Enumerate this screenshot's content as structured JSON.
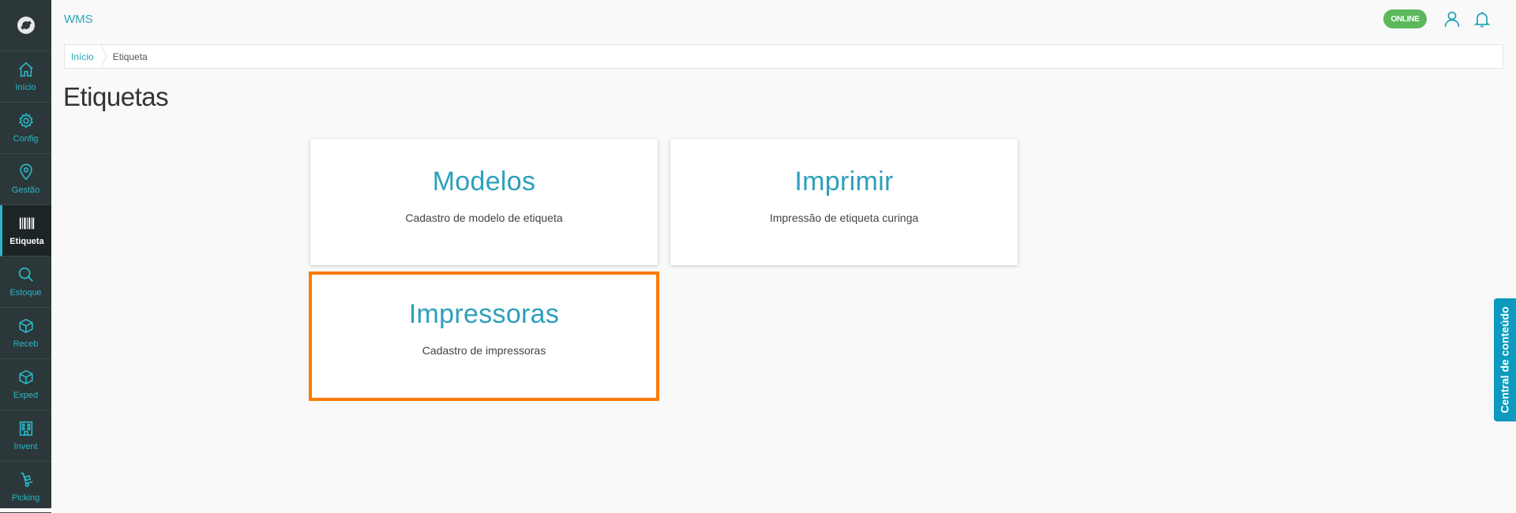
{
  "header": {
    "app_title": "WMS",
    "status": "ONLINE"
  },
  "icons": {
    "user": "user-icon",
    "bell": "bell-icon",
    "logo": "app-logo-icon"
  },
  "sidebar": {
    "items": [
      {
        "label": "Início",
        "icon": "home-icon"
      },
      {
        "label": "Config",
        "icon": "gear-icon"
      },
      {
        "label": "Gestão",
        "icon": "location-pin-icon"
      },
      {
        "label": "Etiqueta",
        "icon": "barcode-icon",
        "active": true
      },
      {
        "label": "Estoque",
        "icon": "search-icon"
      },
      {
        "label": "Receb",
        "icon": "box-icon"
      },
      {
        "label": "Exped",
        "icon": "box-icon"
      },
      {
        "label": "Invent",
        "icon": "building-icon"
      },
      {
        "label": "Picking",
        "icon": "hand-truck-icon"
      }
    ]
  },
  "breadcrumb": {
    "home": "Início",
    "current": "Etiqueta"
  },
  "page": {
    "title": "Etiquetas"
  },
  "cards": [
    {
      "title": "Modelos",
      "description": "Cadastro de modelo de etiqueta"
    },
    {
      "title": "Imprimir",
      "description": "Impressão de etiqueta curinga"
    },
    {
      "title": "Impressoras",
      "description": "Cadastro de impressoras",
      "highlighted": true
    }
  ],
  "side_tab": {
    "label": "Central de conteúdo"
  },
  "colors": {
    "accent": "#29a5b8",
    "sidebar_bg": "#2c3739",
    "online": "#5cb85c",
    "highlight": "#ff7a00",
    "side_tab": "#0c9abf"
  }
}
